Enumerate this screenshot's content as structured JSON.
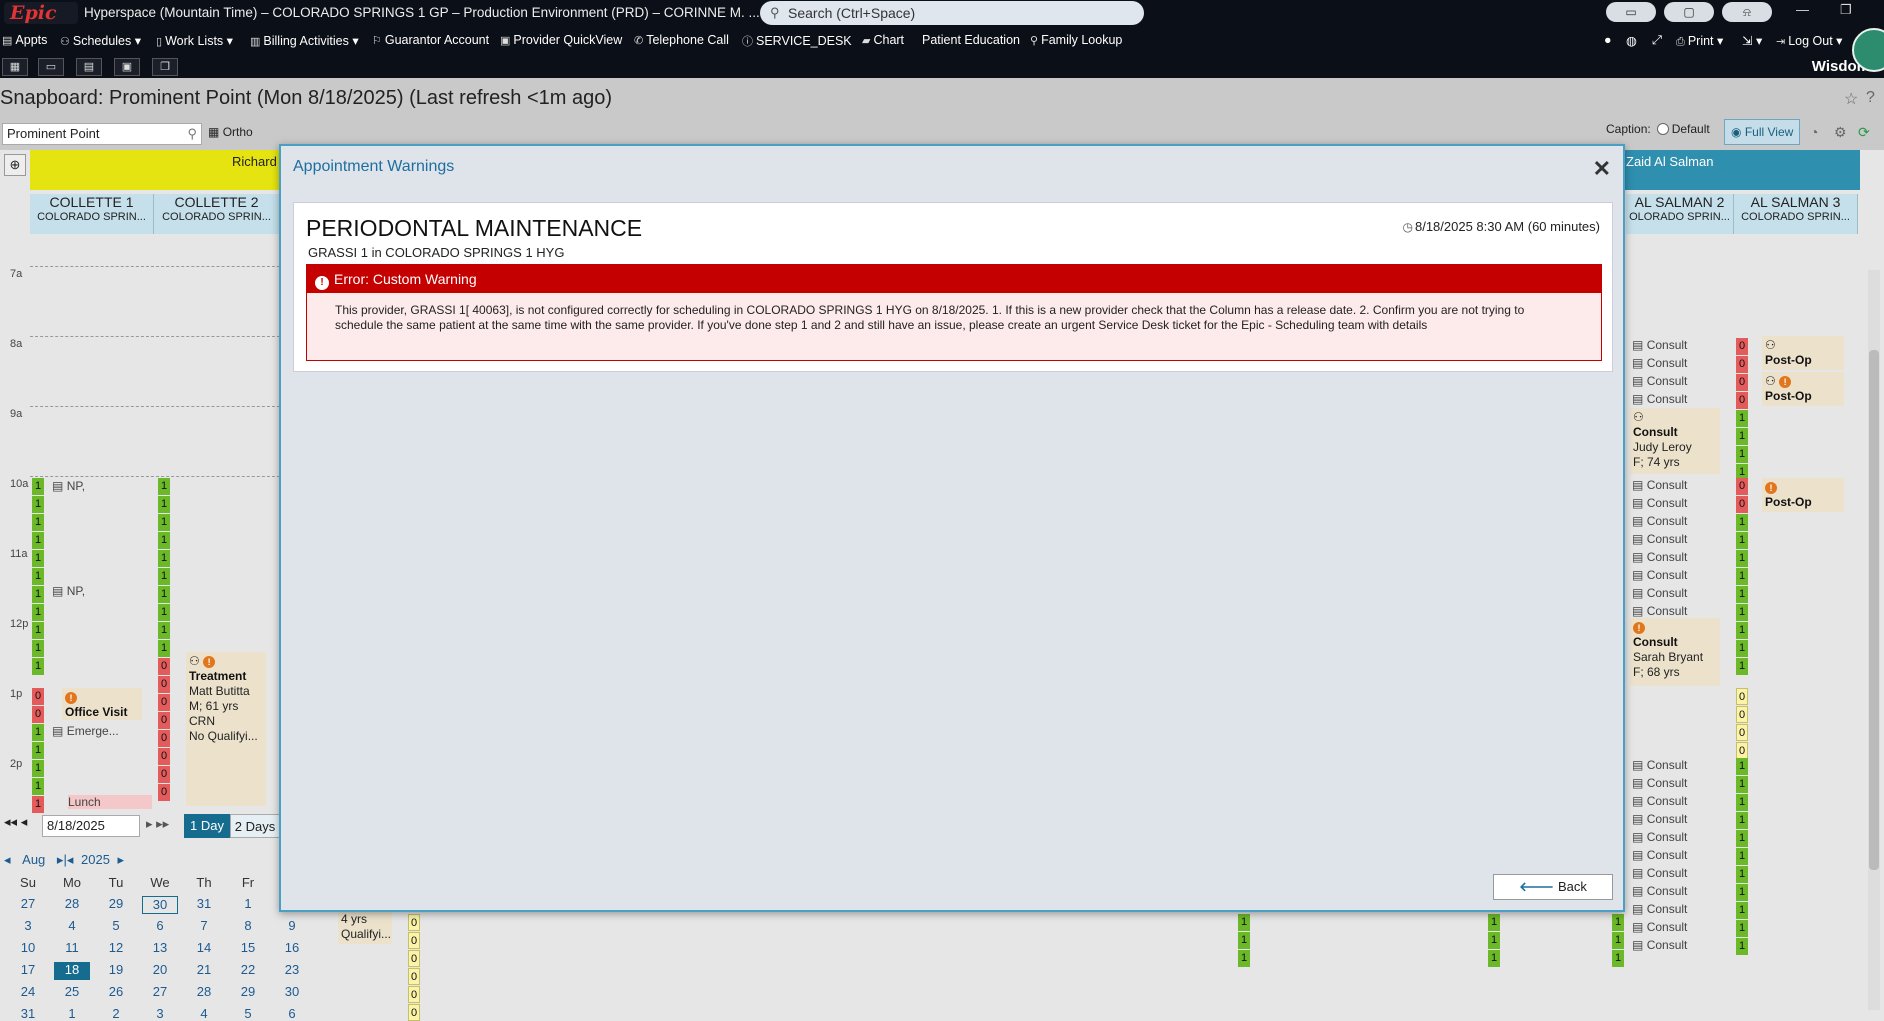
{
  "titlebar": {
    "logo": "Epic",
    "title": "Hyperspace (Mountain Time) – COLORADO SPRINGS 1 GP – Production Environment (PRD) – CORINNE M. ...",
    "search_placeholder": "Search (Ctrl+Space)"
  },
  "menu": {
    "items": [
      "Appts",
      "Schedules",
      "Work Lists",
      "Billing Activities",
      "Guarantor Account",
      "Provider QuickView",
      "Telephone Call",
      "SERVICE_DESK",
      "Chart",
      "Patient Education",
      "Family Lookup"
    ],
    "print": "Print",
    "logout": "Log Out",
    "wisdom": "Wisdom"
  },
  "page": {
    "title": "Snapboard: Prominent Point (Mon 8/18/2025) (Last refresh <1m ago)",
    "dept_value": "Prominent Point",
    "ortho_label": "Ortho",
    "caption_label": "Caption:",
    "caption_default": "Default",
    "caption_full": "Full View"
  },
  "grid": {
    "provider_left": "Richard",
    "provider_right": "Zaid Al Salman",
    "columns": [
      {
        "name": "COLLETTE 1",
        "sub": "COLORADO SPRIN..."
      },
      {
        "name": "COLLETTE 2",
        "sub": "COLORADO SPRIN..."
      },
      {
        "name": "AL SALMAN 2",
        "sub": "OLORADO SPRIN..."
      },
      {
        "name": "AL SALMAN 3",
        "sub": "COLORADO SPRIN..."
      }
    ],
    "times": [
      "7a",
      "8a",
      "9a",
      "10a",
      "11a",
      "12p",
      "1p",
      "2p"
    ],
    "np_label": "NP,",
    "office_visit": "Office Visit",
    "emerge": "Emerge...",
    "lunch": "Lunch",
    "treatment": {
      "title": "Treatment",
      "line1": "Matt Butitta",
      "line2": "M; 61 yrs",
      "line3": "CRN",
      "line4": "No Qualifyi..."
    },
    "consult": "Consult",
    "consult_judy": {
      "title": "Consult",
      "line1": "Judy Leroy",
      "line2": "F; 74 yrs"
    },
    "consult_sarah": {
      "title": "Consult",
      "line1": "Sarah Bryant",
      "line2": "F; 68 yrs"
    },
    "postop": "Post-Op",
    "partial_left": {
      "line1": "4 yrs",
      "line2": "Qualifyi..."
    }
  },
  "nav": {
    "date": "8/18/2025",
    "one_day": "1 Day",
    "two_days": "2 Days",
    "month": "Aug",
    "year": "2025",
    "dow": [
      "Su",
      "Mo",
      "Tu",
      "We",
      "Th",
      "Fr"
    ],
    "weeks": [
      [
        "27",
        "28",
        "29",
        "30",
        "31",
        "1",
        ""
      ],
      [
        "3",
        "4",
        "5",
        "6",
        "7",
        "8",
        "9"
      ],
      [
        "10",
        "11",
        "12",
        "13",
        "14",
        "15",
        "16"
      ],
      [
        "17",
        "18",
        "19",
        "20",
        "21",
        "22",
        "23"
      ],
      [
        "24",
        "25",
        "26",
        "27",
        "28",
        "29",
        "30"
      ],
      [
        "31",
        "1",
        "2",
        "3",
        "4",
        "5",
        "6"
      ]
    ]
  },
  "modal": {
    "title": "Appointment Warnings",
    "appt_title": "PERIODONTAL MAINTENANCE",
    "appt_sub": "GRASSI 1 in COLORADO SPRINGS 1 HYG",
    "appt_time": "8/18/2025 8:30 AM (60 minutes)",
    "error_title": "Error: Custom Warning",
    "error_message": "This provider, GRASSI 1[ 40063], is not configured correctly for scheduling in COLORADO SPRINGS 1 HYG on 8/18/2025. 1. If this is a new provider check that the Column has a release date. 2. Confirm you are not trying to schedule the same patient at the same time with the same provider. If you've done step 1 and 2 and still have an issue, please create an urgent Service Desk ticket for the Epic - Scheduling team with details",
    "back": "Back"
  },
  "colors": {
    "accent": "#166c8f",
    "error": "#c40000",
    "slot_green": "#6bb928",
    "slot_red": "#e35b5b",
    "provider_yellow": "#e5e411",
    "provider_teal": "#2e8fae"
  }
}
